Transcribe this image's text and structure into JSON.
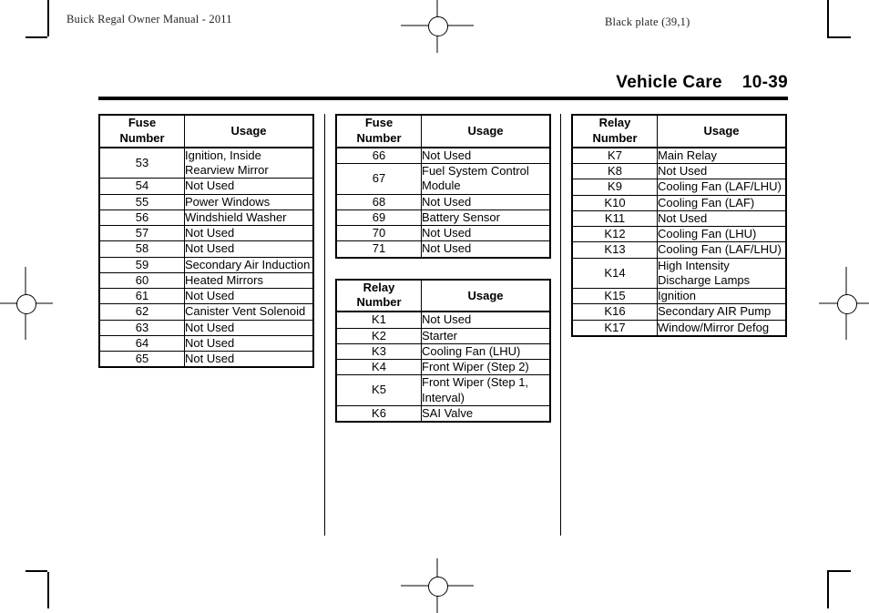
{
  "page": {
    "running_head_left": "Buick Regal Owner Manual - 2011",
    "running_head_right": "Black plate (39,1)",
    "section_title": "Vehicle Care",
    "page_number": "10-39"
  },
  "tables": [
    {
      "id": "fuse-table-53-65",
      "column": 1,
      "headers": {
        "number_line1": "Fuse",
        "number_line2": "Number",
        "usage": "Usage"
      },
      "rows": [
        {
          "number": "53",
          "usage": "Ignition, Inside Rearview Mirror"
        },
        {
          "number": "54",
          "usage": "Not Used"
        },
        {
          "number": "55",
          "usage": "Power Windows"
        },
        {
          "number": "56",
          "usage": "Windshield Washer"
        },
        {
          "number": "57",
          "usage": "Not Used"
        },
        {
          "number": "58",
          "usage": "Not Used"
        },
        {
          "number": "59",
          "usage": "Secondary Air Induction"
        },
        {
          "number": "60",
          "usage": "Heated Mirrors"
        },
        {
          "number": "61",
          "usage": "Not Used"
        },
        {
          "number": "62",
          "usage": "Canister Vent Solenoid"
        },
        {
          "number": "63",
          "usage": "Not Used"
        },
        {
          "number": "64",
          "usage": "Not Used"
        },
        {
          "number": "65",
          "usage": "Not Used"
        }
      ]
    },
    {
      "id": "fuse-table-66-71",
      "column": 2,
      "headers": {
        "number_line1": "Fuse",
        "number_line2": "Number",
        "usage": "Usage"
      },
      "rows": [
        {
          "number": "66",
          "usage": "Not Used"
        },
        {
          "number": "67",
          "usage": "Fuel System Control Module"
        },
        {
          "number": "68",
          "usage": "Not Used"
        },
        {
          "number": "69",
          "usage": "Battery Sensor"
        },
        {
          "number": "70",
          "usage": "Not Used"
        },
        {
          "number": "71",
          "usage": "Not Used"
        }
      ]
    },
    {
      "id": "relay-table-k1-k6",
      "column": 2,
      "headers": {
        "number_line1": "Relay",
        "number_line2": "Number",
        "usage": "Usage"
      },
      "rows": [
        {
          "number": "K1",
          "usage": "Not Used"
        },
        {
          "number": "K2",
          "usage": "Starter"
        },
        {
          "number": "K3",
          "usage": "Cooling Fan (LHU)"
        },
        {
          "number": "K4",
          "usage": "Front Wiper (Step 2)"
        },
        {
          "number": "K5",
          "usage": "Front Wiper (Step 1, Interval)"
        },
        {
          "number": "K6",
          "usage": "SAI Valve"
        }
      ]
    },
    {
      "id": "relay-table-k7-k17",
      "column": 3,
      "headers": {
        "number_line1": "Relay",
        "number_line2": "Number",
        "usage": "Usage"
      },
      "rows": [
        {
          "number": "K7",
          "usage": "Main Relay"
        },
        {
          "number": "K8",
          "usage": "Not Used"
        },
        {
          "number": "K9",
          "usage": "Cooling Fan (LAF/LHU)"
        },
        {
          "number": "K10",
          "usage": "Cooling Fan (LAF)"
        },
        {
          "number": "K11",
          "usage": "Not Used"
        },
        {
          "number": "K12",
          "usage": "Cooling Fan (LHU)"
        },
        {
          "number": "K13",
          "usage": "Cooling Fan (LAF/LHU)"
        },
        {
          "number": "K14",
          "usage": "High Intensity Discharge Lamps"
        },
        {
          "number": "K15",
          "usage": "Ignition"
        },
        {
          "number": "K16",
          "usage": "Secondary AIR Pump"
        },
        {
          "number": "K17",
          "usage": "Window/Mirror Defog"
        }
      ]
    }
  ]
}
